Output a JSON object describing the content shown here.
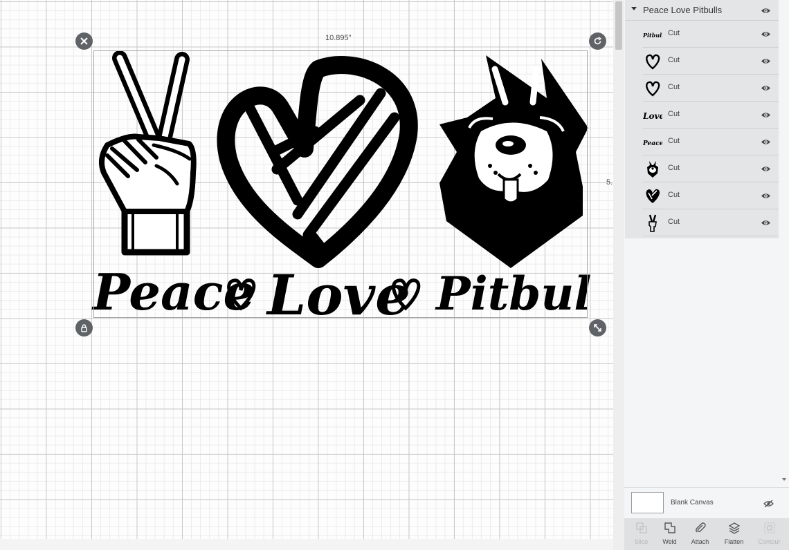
{
  "canvas": {
    "width_dimension": "10.895\"",
    "height_dimension": "5."
  },
  "layers_panel": {
    "group_title": "Peace Love Pitbulls",
    "layers": [
      {
        "thumb": "Pitbulls",
        "label": "Cut"
      },
      {
        "thumb": "heart-outline",
        "label": "Cut"
      },
      {
        "thumb": "heart-outline",
        "label": "Cut"
      },
      {
        "thumb": "Love",
        "label": "Cut"
      },
      {
        "thumb": "Peace",
        "label": "Cut"
      },
      {
        "thumb": "pitbull-head",
        "label": "Cut"
      },
      {
        "thumb": "striped-heart",
        "label": "Cut"
      },
      {
        "thumb": "peace-hand",
        "label": "Cut"
      }
    ],
    "blank_canvas_label": "Blank Canvas"
  },
  "toolbar": {
    "slice": "Slice",
    "weld": "Weld",
    "attach": "Attach",
    "flatten": "Flatten",
    "contour": "Contour"
  },
  "design_text": {
    "peace": "Peace",
    "love": "Love",
    "pitbulls": "Pitbulls"
  },
  "colors": {
    "handle": "#5f6367",
    "panel_bg": "#f4f5f6",
    "group_bg": "#e4e5e6"
  }
}
